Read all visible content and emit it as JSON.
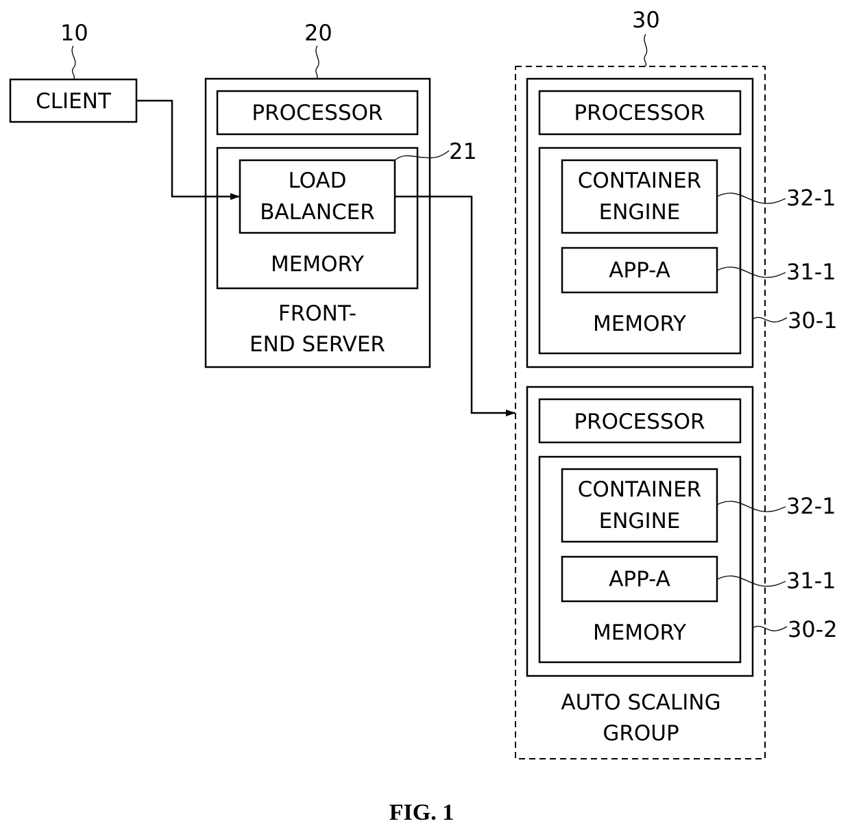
{
  "figure": {
    "caption": "FIG. 1"
  },
  "client": {
    "ref": "10",
    "label": "CLIENT"
  },
  "front_end_server": {
    "ref": "20",
    "processor": "PROCESSOR",
    "load_balancer": {
      "ref": "21",
      "line1": "LOAD",
      "line2": "BALANCER"
    },
    "memory": "MEMORY",
    "label_line1": "FRONT-",
    "label_line2": "END SERVER"
  },
  "auto_scaling_group": {
    "ref": "30",
    "label_line1": "AUTO SCALING",
    "label_line2": "GROUP",
    "servers": [
      {
        "ref": "30-1",
        "processor": "PROCESSOR",
        "container_engine": {
          "ref": "32-1",
          "line1": "CONTAINER",
          "line2": "ENGINE"
        },
        "app": {
          "ref": "31-1",
          "label": "APP-A"
        },
        "memory": "MEMORY"
      },
      {
        "ref": "30-2",
        "processor": "PROCESSOR",
        "container_engine": {
          "ref": "32-1",
          "line1": "CONTAINER",
          "line2": "ENGINE"
        },
        "app": {
          "ref": "31-1",
          "label": "APP-A"
        },
        "memory": "MEMORY"
      }
    ]
  }
}
